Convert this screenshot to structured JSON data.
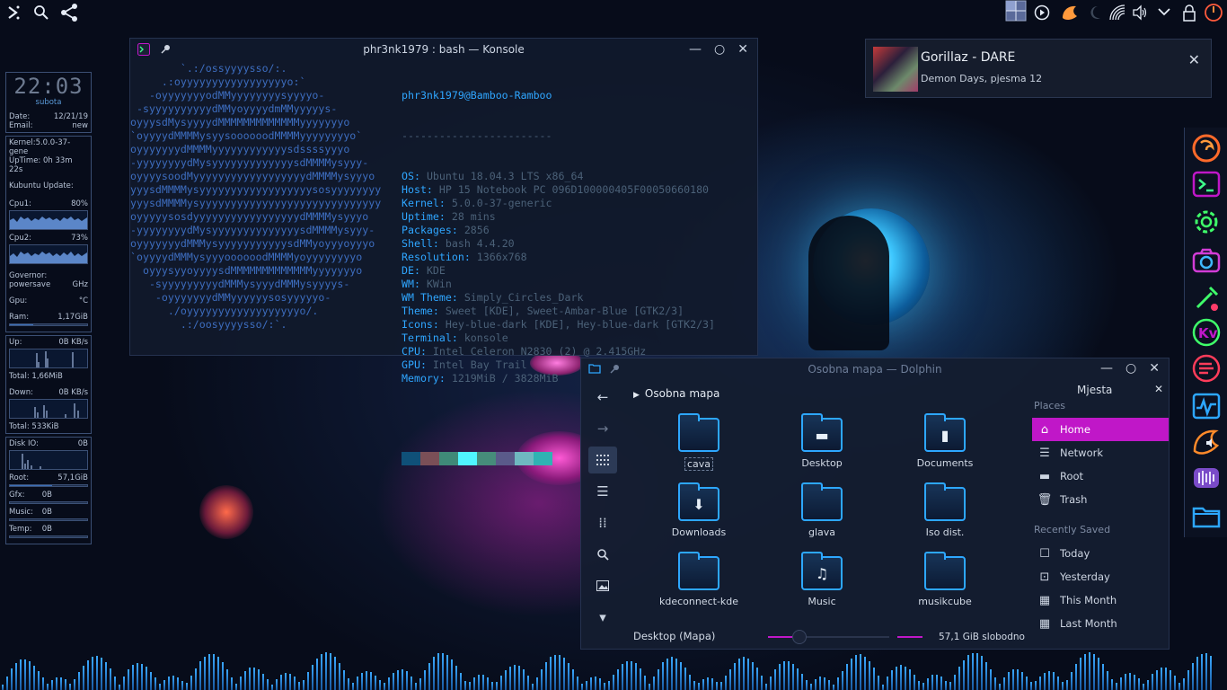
{
  "conky": {
    "clock": "22:03",
    "day": "subota",
    "date_label": "Date:",
    "date_value": "12/21/19",
    "email_label": "Email:",
    "email_value": "new",
    "kernel": "Kernel:5.0.0-37-gene",
    "uptime": "UpTime: 0h 33m 22s",
    "update": "Kubuntu Update:",
    "cpu1_label": "Cpu1:",
    "cpu1_value": "80%",
    "cpu2_label": "Cpu2:",
    "cpu2_value": "73%",
    "governor_label": "Governor:",
    "governor_value": "powersave",
    "ghz": "GHz",
    "gpu_label": "Gpu:",
    "gpu_value": "°C",
    "ram_label": "Ram:",
    "ram_value": "1,17GiB",
    "ram_fill": 0.3,
    "up_label": "Up:",
    "up_value": "0B  KB/s",
    "up_total": "Total: 1,66MiB",
    "down_label": "Down:",
    "down_value": "0B  KB/s",
    "down_total": "Total: 533KiB",
    "diskio_label": "Disk IO:",
    "diskio_value": "0B",
    "root_label": "Root:",
    "root_value": "57,1GiB",
    "root_fill": 0.55,
    "gfx_label": "Gfx:",
    "gfx_value": "0B",
    "music_label": "Music:",
    "music_value": "0B",
    "temp_label": "Temp:",
    "temp_value": "0B"
  },
  "konsole": {
    "title": "phr3nk1979 : bash — Konsole",
    "user_host": "phr3nk1979@Bamboo-Ramboo",
    "separator": "------------------------",
    "art": [
      "        `.:/ossyyyysso/:.",
      "     .:oyyyyyyyyyyyyyyyyyo:`",
      "   -oyyyyyyyodMMyyyyyyyysyyyyo-",
      " -syyyyyyyyyydMMyoyyyydmMMyyyyys-",
      "oyyysdMysyyyydMMMMMMMMMMMMMyyyyyyyo",
      "`oyyyydMMMMysyysoooooodMMMMyyyyyyyyo`",
      "oyyyyyyydMMMMyyyyyyyyyyyysdssssyyyo",
      "-yyyyyyyydMysyyyyyyyyyyyyysdMMMMysyyy-",
      "oyyyysoodMyyyyyyyyyyyyyyyyyydMMMMysyyyo",
      "yyysdMMMMysyyyyyyyyyyyyyyyyyysosyyyyyyyy",
      "yyysdMMMMysyyyyyyyyyyyyyyyyyyyyyyyyyyyyy",
      "oyyyyysosdyyyyyyyyyyyyyyyyydMMMMysyyyo",
      "-yyyyyyyydMysyyyyyyyyyyyyyysdMMMMysyyy-",
      "oyyyyyyydMMMysyyyyyyyyyyysdMMyoyyyoyyyo",
      "`oyyyydMMMysyyyoooooodMMMMyoyyyyyyyyo",
      "  oyyysyyoyyyysdMMMMMMMMMMMMMyyyyyyyo",
      "   -syyyyyyyyydMMMysyyydMMMysyyyys-",
      "    -oyyyyyyydMMyyyyyysosyyyyyo-",
      "      ./oyyyyyyyyyyyyyyyyyyo/.",
      "        .:/oosyyyysso/:`."
    ],
    "info": [
      {
        "k": "OS",
        "v": "Ubuntu 18.04.3 LTS x86_64"
      },
      {
        "k": "Host",
        "v": "HP 15 Notebook PC 096D100000405F00050660180"
      },
      {
        "k": "Kernel",
        "v": "5.0.0-37-generic"
      },
      {
        "k": "Uptime",
        "v": "28 mins"
      },
      {
        "k": "Packages",
        "v": "2856"
      },
      {
        "k": "Shell",
        "v": "bash 4.4.20"
      },
      {
        "k": "Resolution",
        "v": "1366x768"
      },
      {
        "k": "DE",
        "v": "KDE"
      },
      {
        "k": "WM",
        "v": "KWin"
      },
      {
        "k": "WM Theme",
        "v": "Simply_Circles_Dark"
      },
      {
        "k": "Theme",
        "v": "Sweet [KDE], Sweet-Ambar-Blue [GTK2/3]"
      },
      {
        "k": "Icons",
        "v": "Hey-blue-dark [KDE], Hey-blue-dark [GTK2/3]"
      },
      {
        "k": "Terminal",
        "v": "konsole"
      },
      {
        "k": "CPU",
        "v": "Intel Celeron N2830 (2) @ 2.415GHz"
      },
      {
        "k": "GPU",
        "v": "Intel Bay Trail"
      },
      {
        "k": "Memory",
        "v": "1219MiB / 3828MiB"
      }
    ],
    "swatches": [
      "#0f5078",
      "#7a4f57",
      "#3f8a78",
      "#4ff5ff",
      "#468c7a",
      "#5a5a8a",
      "#6fb8c0",
      "#30b3b3"
    ]
  },
  "notification": {
    "title": "Gorillaz - DARE",
    "subtitle": "Demon Days, pjesma 12",
    "close": "✕"
  },
  "dolphin": {
    "title": "Osobna mapa — Dolphin",
    "breadcrumb": "Osobna mapa",
    "files": [
      {
        "name": "cava",
        "glyph": ""
      },
      {
        "name": "Desktop",
        "glyph": "▬"
      },
      {
        "name": "Documents",
        "glyph": "▮"
      },
      {
        "name": "Downloads",
        "glyph": "⬇"
      },
      {
        "name": "glava",
        "glyph": ""
      },
      {
        "name": "Iso dist.",
        "glyph": ""
      },
      {
        "name": "kdeconnect-kde",
        "glyph": ""
      },
      {
        "name": "Music",
        "glyph": "♫"
      },
      {
        "name": "musikcube",
        "glyph": ""
      }
    ],
    "places_header": "Mjesta",
    "places_section": "Places",
    "places": [
      {
        "label": "Home",
        "icon": "⌂"
      },
      {
        "label": "Network",
        "icon": "☰"
      },
      {
        "label": "Root",
        "icon": "▬"
      },
      {
        "label": "Trash",
        "icon": "🗑"
      }
    ],
    "recent_section": "Recently Saved",
    "recent": [
      {
        "label": "Today",
        "icon": "☐"
      },
      {
        "label": "Yesterday",
        "icon": "⊡"
      },
      {
        "label": "This Month",
        "icon": "▦"
      },
      {
        "label": "Last Month",
        "icon": "▦"
      }
    ],
    "status_text": "Desktop (Mapa)",
    "free_space": "57,1 GiB slobodno",
    "zoom_level": 0.2,
    "free_fraction": 0.3
  },
  "colors": {
    "accent": "#c017c8",
    "blue": "#2da7ff",
    "term_key": "#2fa6ff",
    "term_value": "#4b6178"
  }
}
